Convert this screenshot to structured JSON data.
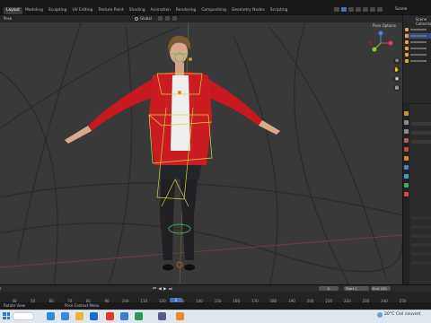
{
  "workspace_tabs": [
    "Layout",
    "Modeling",
    "Sculpting",
    "UV Editing",
    "Texture Paint",
    "Shading",
    "Animation",
    "Rendering",
    "Compositing",
    "Geometry Nodes",
    "Scripting"
  ],
  "active_tab": "Layout",
  "scene_label": "Scene",
  "viewport": {
    "mode": "Pose",
    "transform_orientation": "Global",
    "pose_options": "Pose Options"
  },
  "outliner": {
    "title": "Scene Collection"
  },
  "timeline": {
    "view_label": "r",
    "current_frame": "1",
    "start_label": "Start",
    "start_value": "1",
    "end_label": "End",
    "end_value": "250",
    "playhead_label": "1",
    "ticks": [
      "40",
      "50",
      "60",
      "70",
      "80",
      "90",
      "100",
      "110",
      "120",
      "130",
      "140",
      "150",
      "160",
      "170",
      "180",
      "190",
      "200",
      "210",
      "220",
      "230",
      "240",
      "250"
    ]
  },
  "statusbar": {
    "left": "Rotate View",
    "mid": "Pose Context Menu"
  },
  "taskbar": {
    "weather": "20°C  Ciel couvert"
  }
}
